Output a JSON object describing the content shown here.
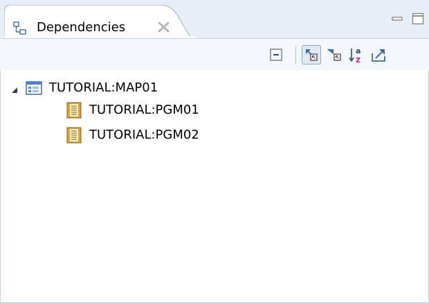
{
  "view": {
    "title": "Dependencies",
    "tab_icon": "hierarchy-icon",
    "close_icon": "close-icon",
    "minimize_icon": "minimize-icon",
    "maximize_icon": "maximize-icon"
  },
  "toolbar": {
    "buttons": [
      {
        "name": "collapse-all-button",
        "icon": "collapse-all-icon",
        "pressed": false
      },
      {
        "name": "show-callers-button",
        "icon": "callers-icon",
        "pressed": true
      },
      {
        "name": "show-callees-button",
        "icon": "callees-icon",
        "pressed": false
      },
      {
        "name": "sort-alphabetically-button",
        "icon": "sort-az-icon",
        "pressed": false
      },
      {
        "name": "export-button",
        "icon": "export-icon",
        "pressed": false
      }
    ]
  },
  "tree": {
    "root": {
      "label": "TUTORIAL:MAP01",
      "icon": "map-icon",
      "expanded": true,
      "children": [
        {
          "label": "TUTORIAL:PGM01",
          "icon": "program-icon"
        },
        {
          "label": "TUTORIAL:PGM02",
          "icon": "program-icon"
        }
      ]
    }
  },
  "colors": {
    "tab_strip": "#e7eef6",
    "toolbar": "#f3f6fa",
    "border": "#c8d3df",
    "accent": "#3a6ea5"
  }
}
